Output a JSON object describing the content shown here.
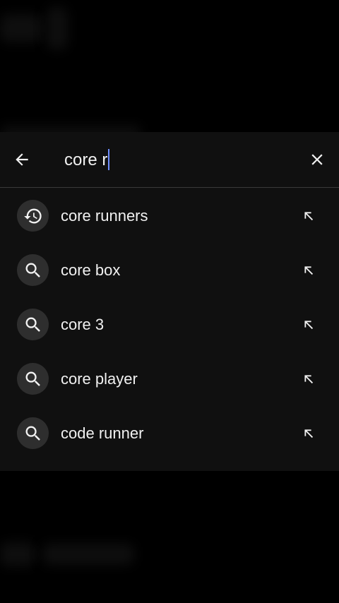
{
  "search": {
    "query": "core r",
    "back_icon": "arrow-left-icon",
    "clear_icon": "close-icon"
  },
  "suggestions": [
    {
      "text": "core runners",
      "icon": "history-icon"
    },
    {
      "text": "core box",
      "icon": "search-icon"
    },
    {
      "text": "core 3",
      "icon": "search-icon"
    },
    {
      "text": "core player",
      "icon": "search-icon"
    },
    {
      "text": "code runner",
      "icon": "search-icon"
    }
  ],
  "colors": {
    "background": "#000000",
    "panel": "#101010",
    "text": "#f1f1f1",
    "icon_circle": "#2e2e2e",
    "caret": "#6f8fff"
  }
}
